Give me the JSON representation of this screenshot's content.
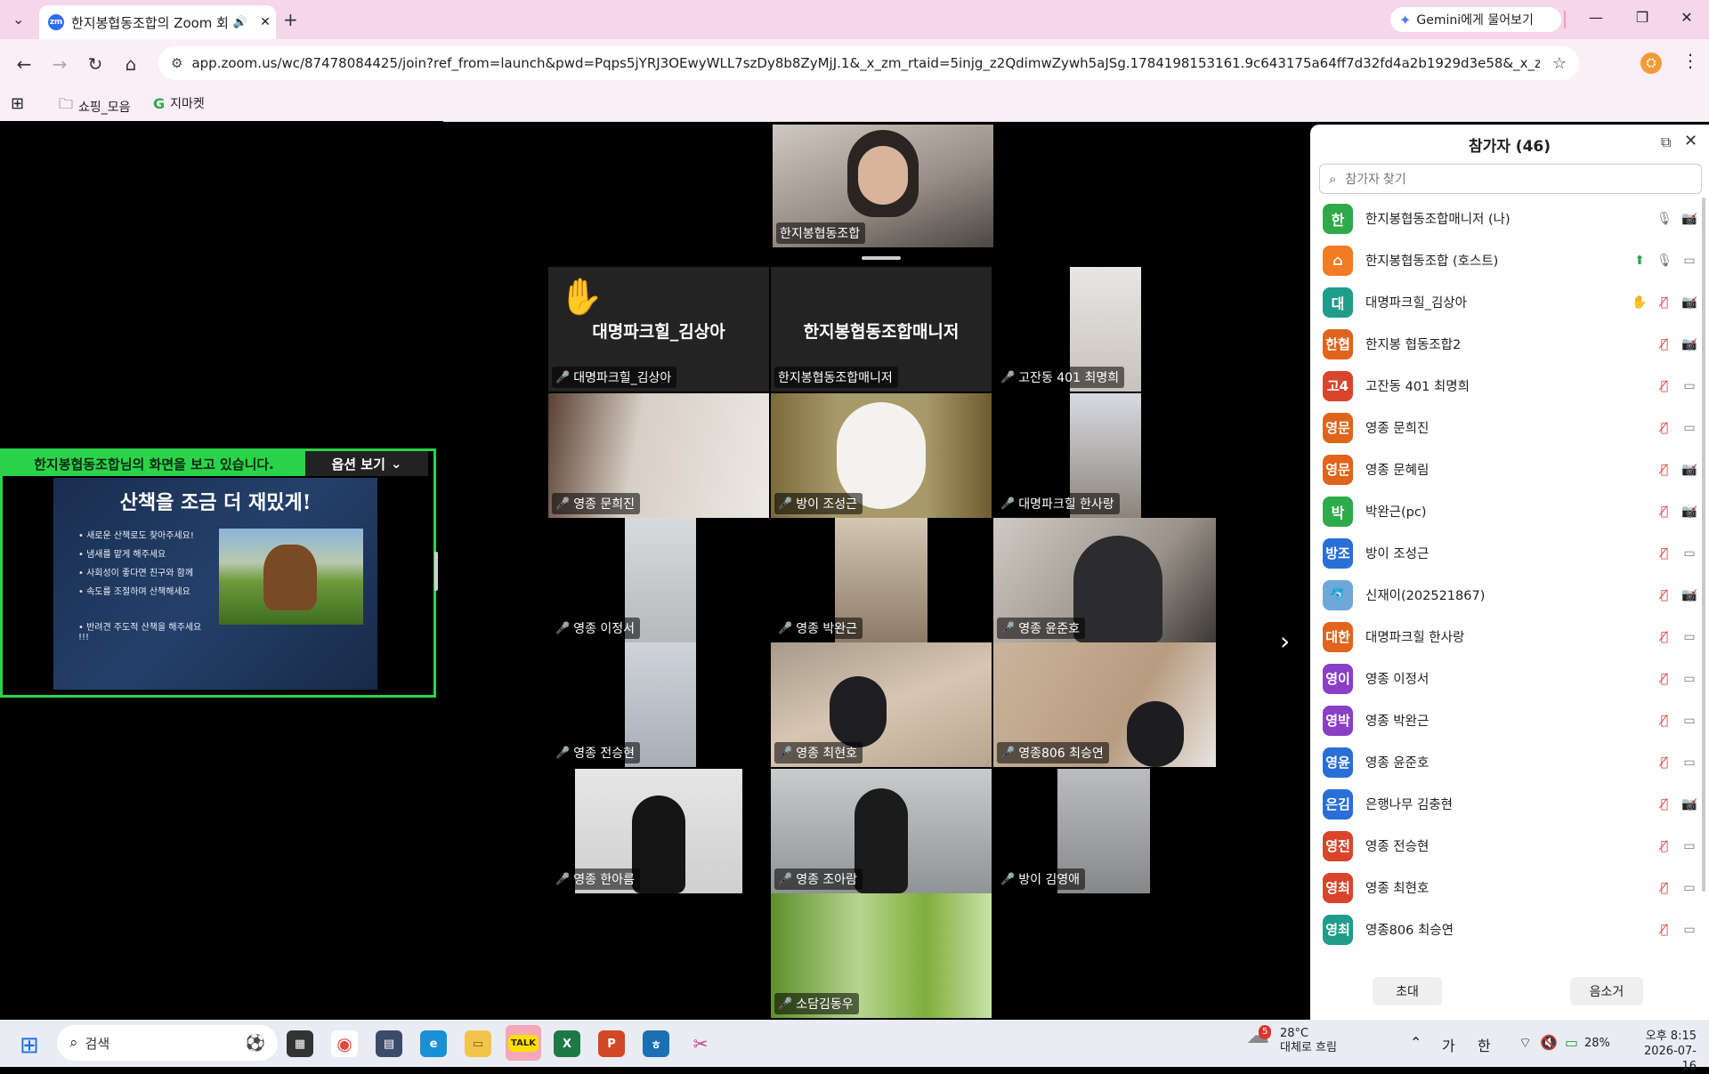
{
  "browser": {
    "tab_title": "한지봉협동조합의 Zoom 회",
    "tab_favicon": "zm",
    "gemini_button": "Gemini에게 물어보기",
    "url": "app.zoom.us/wc/87478084425/join?ref_from=launch&pwd=Pqps5jYRJ3OEwyWLL7szDy8b8ZyMjJ.1&_x_zm_rtaid=5injg_z2QdimwZywh5aJSg.1784198153161.9c643175a64ff7d32fd4a2b1929d3e58&_x_zm_rhtaid=586&fr...",
    "bookmarks": [
      "쇼핑_모음",
      "지마켓"
    ],
    "profile_letter": "⛭"
  },
  "share": {
    "banner": "한지봉협동조합님의 화면을 보고 있습니다.",
    "options_label": "옵션 보기",
    "slide_title": "산책을 조금 더 재밌게!",
    "bullets": [
      "• 새로운 산책로도 찾아주세요!",
      "• 냄새를 맡게 해주세요",
      "• 사회성이 좋다면 친구와 함께",
      "• 속도를 조절하며 산책해세요",
      "• 반려견 주도적 산책을 해주세요 !!!"
    ]
  },
  "gallery": {
    "tiles": [
      {
        "name": "한지봉협동조합",
        "muted": false
      },
      {
        "name": "대명파크힐_김상아",
        "muted": true,
        "big": "대명파크힐_김상아"
      },
      {
        "name": "한지봉협동조합매니저",
        "muted": false,
        "big": "한지봉협동조합매니저"
      },
      {
        "name": "고잔동 401 최명희",
        "muted": true
      },
      {
        "name": "영종 문희진",
        "muted": true
      },
      {
        "name": "방이 조성근",
        "muted": true
      },
      {
        "name": "대명파크힐 한사랑",
        "muted": true
      },
      {
        "name": "영종 이정서",
        "muted": true
      },
      {
        "name": "영종 박완근",
        "muted": true
      },
      {
        "name": "영종 윤준호",
        "muted": true
      },
      {
        "name": "영종 전승현",
        "muted": true
      },
      {
        "name": "영종 최현호",
        "muted": true
      },
      {
        "name": "영종806 최승연",
        "muted": true
      },
      {
        "name": "영종 한아름",
        "muted": true
      },
      {
        "name": "영종 조아람",
        "muted": true
      },
      {
        "name": "방이 김영애",
        "muted": true
      },
      {
        "name": "소담김동우",
        "muted": true
      }
    ]
  },
  "participants": {
    "title": "참가자 (46)",
    "search_placeholder": "참가자 찾기",
    "list": [
      {
        "avatar": "한",
        "color": "#2faa4a",
        "name": "한지봉협동조합매니저 (나)",
        "mic": "on",
        "cam": "off"
      },
      {
        "avatar": "⌂",
        "color": "#f27b24",
        "name": "한지봉협동조합 (호스트)",
        "mic": "on",
        "cam": "on",
        "share": true
      },
      {
        "avatar": "대",
        "color": "#1f9d8a",
        "name": "대명파크힐_김상아",
        "mic": "off",
        "cam": "off",
        "hand": true
      },
      {
        "avatar": "한협",
        "color": "#e0641b",
        "name": "한지봉 협동조합2",
        "mic": "off",
        "cam": "off"
      },
      {
        "avatar": "고4",
        "color": "#d9452b",
        "name": "고잔동 401 최명희",
        "mic": "off",
        "cam": "on"
      },
      {
        "avatar": "영문",
        "color": "#e0641b",
        "name": "영종 문희진",
        "mic": "off",
        "cam": "on"
      },
      {
        "avatar": "영문",
        "color": "#e0641b",
        "name": "영종 문혜림",
        "mic": "off",
        "cam": "off"
      },
      {
        "avatar": "박",
        "color": "#2faa4a",
        "name": "박완근(pc)",
        "mic": "off",
        "cam": "off"
      },
      {
        "avatar": "방조",
        "color": "#2a6fd6",
        "name": "방이 조성근",
        "mic": "off",
        "cam": "on"
      },
      {
        "avatar": "🐬",
        "color": "#6fa8d8",
        "name": "신재이(202521867)",
        "mic": "off",
        "cam": "off"
      },
      {
        "avatar": "대한",
        "color": "#e0641b",
        "name": "대명파크힐 한사랑",
        "mic": "off",
        "cam": "on"
      },
      {
        "avatar": "영이",
        "color": "#8a3fc7",
        "name": "영종 이정서",
        "mic": "off",
        "cam": "on"
      },
      {
        "avatar": "영박",
        "color": "#8a3fc7",
        "name": "영종 박완근",
        "mic": "off",
        "cam": "on"
      },
      {
        "avatar": "영윤",
        "color": "#2a6fd6",
        "name": "영종 윤준호",
        "mic": "off",
        "cam": "on"
      },
      {
        "avatar": "은김",
        "color": "#2a6fd6",
        "name": "은행나무 김충현",
        "mic": "off",
        "cam": "off"
      },
      {
        "avatar": "영전",
        "color": "#d9452b",
        "name": "영종 전승현",
        "mic": "off",
        "cam": "on"
      },
      {
        "avatar": "영최",
        "color": "#d9452b",
        "name": "영종 최현호",
        "mic": "off",
        "cam": "on"
      },
      {
        "avatar": "영최",
        "color": "#1f9d8a",
        "name": "영종806 최승연",
        "mic": "off",
        "cam": "on"
      }
    ],
    "invite_label": "초대",
    "mute_all_label": "음소거"
  },
  "taskbar": {
    "search_label": "검색",
    "weather_badge": "5",
    "weather_temp": "28°C",
    "weather_desc": "대체로 흐림",
    "ime1": "가",
    "ime2": "한",
    "battery": "28%",
    "time": "오후 8:15",
    "date": "2026-07-16"
  }
}
